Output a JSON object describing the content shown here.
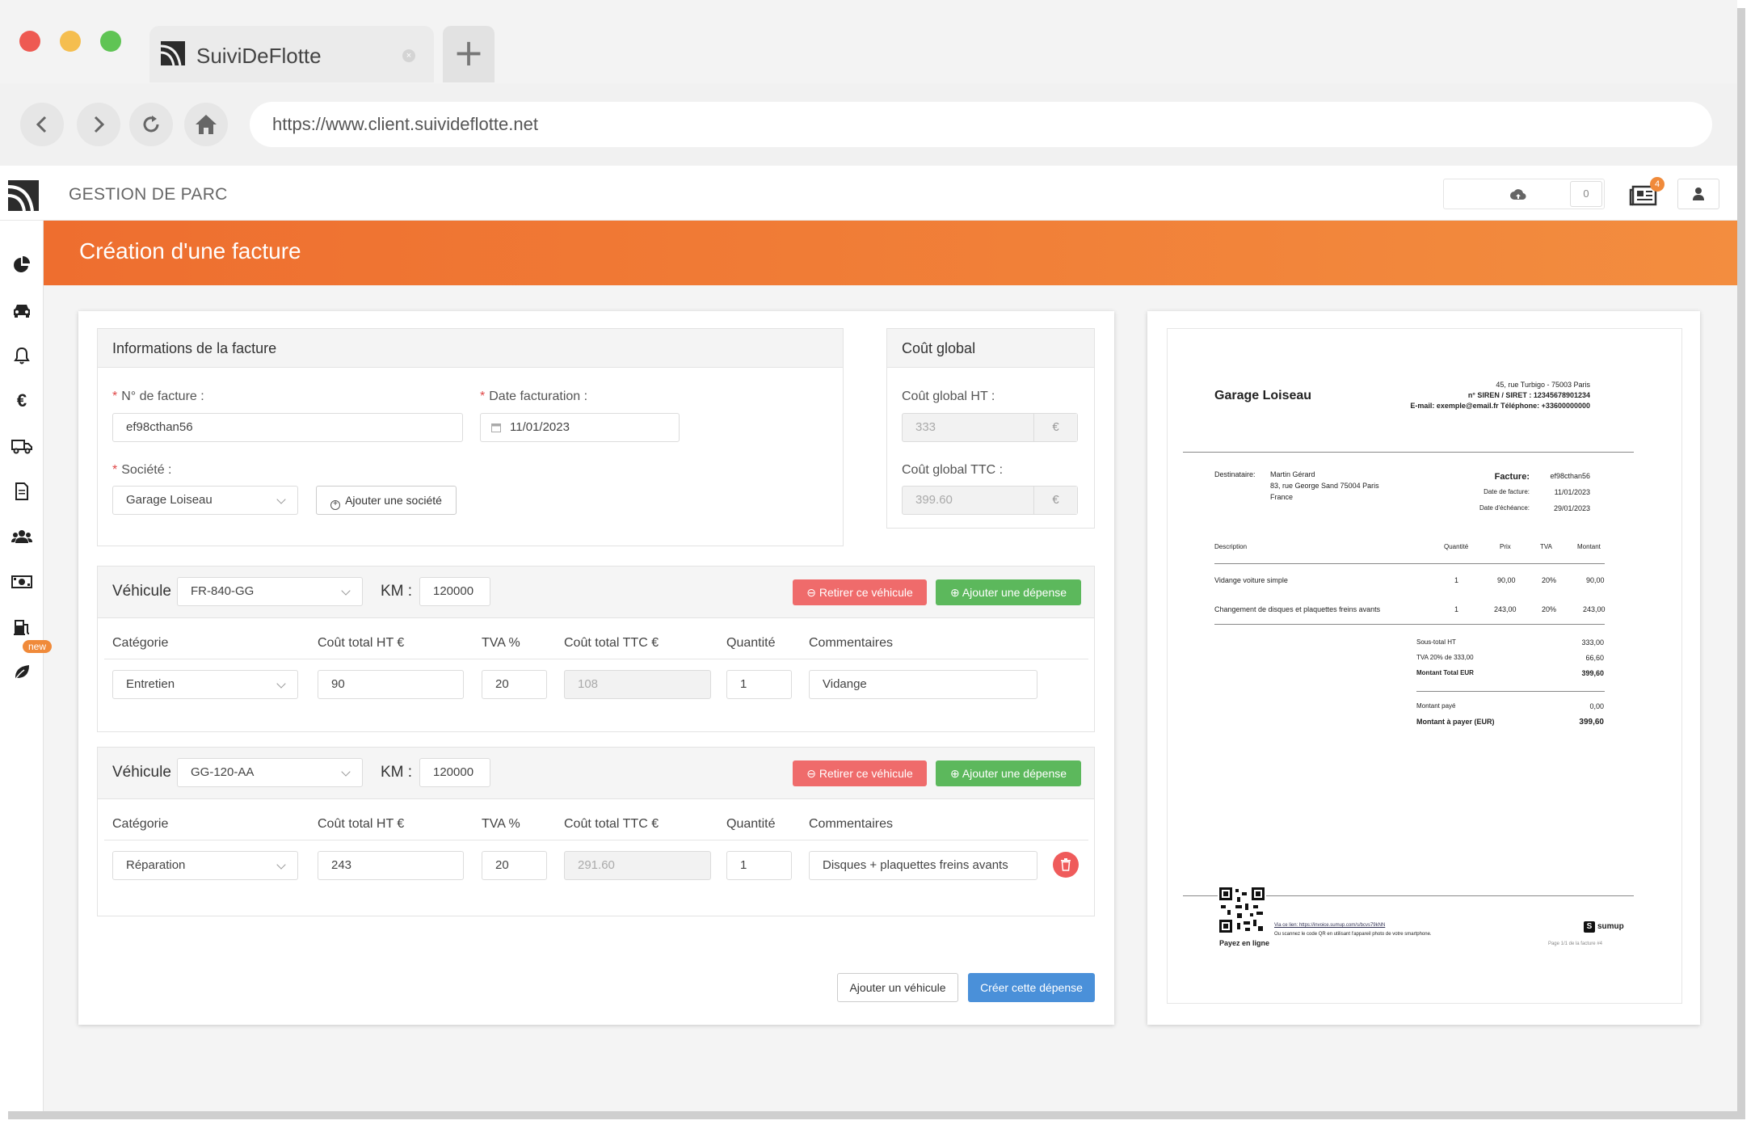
{
  "browser": {
    "tab_title": "SuiviDeFlotte",
    "new_tab": "+",
    "url": "https://www.client.suivideflotte.net"
  },
  "app": {
    "brand": "GESTION DE PARC",
    "sync_count": "0",
    "notification_count": "4",
    "new_badge": "new",
    "page_title": "Création d'une facture"
  },
  "invoice_info": {
    "title": "Informations de la facture",
    "invoice_number_label": "N° de facture :",
    "invoice_number": "ef98cthan56",
    "date_label": "Date facturation :",
    "date": "11/01/2023",
    "company_label": "Société :",
    "company": "Garage Loiseau",
    "add_company": "Ajouter une société"
  },
  "global_cost": {
    "title": "Coût global",
    "ht_label": "Coût global HT :",
    "ht_value": "333",
    "ttc_label": "Coût global TTC :",
    "ttc_value": "399.60",
    "currency": "€"
  },
  "vehicles": [
    {
      "label": "Véhicule",
      "plate": "FR-840-GG",
      "km_label": "KM :",
      "km": "120000",
      "remove_label": "Retirer ce véhicule",
      "add_expense_label": "Ajouter une dépense",
      "columns": [
        "Catégorie",
        "Coût total HT €",
        "TVA %",
        "Coût total TTC €",
        "Quantité",
        "Commentaires"
      ],
      "expense": {
        "category": "Entretien",
        "ht": "90",
        "tva": "20",
        "ttc": "108",
        "qty": "1",
        "comment": "Vidange"
      }
    },
    {
      "label": "Véhicule",
      "plate": "GG-120-AA",
      "km_label": "KM :",
      "km": "120000",
      "remove_label": "Retirer ce véhicule",
      "add_expense_label": "Ajouter une dépense",
      "columns": [
        "Catégorie",
        "Coût total HT €",
        "TVA %",
        "Coût total TTC €",
        "Quantité",
        "Commentaires"
      ],
      "expense": {
        "category": "Réparation",
        "ht": "243",
        "tva": "20",
        "ttc": "291.60",
        "qty": "1",
        "comment": "Disques + plaquettes freins avants"
      }
    }
  ],
  "actions": {
    "add_vehicle": "Ajouter un véhicule",
    "create": "Créer cette dépense"
  },
  "invoice_preview": {
    "company": "Garage Loiseau",
    "address": "45, rue Turbigo - 75003 Paris",
    "siren": "n° SIREN / SIRET : 12345678901234",
    "contact": "E-mail: exemple@email.fr   Téléphone: +33600000000",
    "recipient_label": "Destinataire:",
    "recipient_name": "Martin Gérard",
    "recipient_address": "83, rue George Sand 75004 Paris",
    "recipient_country": "France",
    "invoice_label": "Facture:",
    "invoice_number": "ef98cthan56",
    "date_label": "Date de facture:",
    "date": "11/01/2023",
    "due_label": "Date d'échéance:",
    "due": "29/01/2023",
    "table_headers": [
      "Description",
      "Quantité",
      "Prix",
      "TVA",
      "Montant"
    ],
    "lines": [
      {
        "description": "Vidange voiture simple",
        "qty": "1",
        "price": "90,00",
        "tva": "20%",
        "amount": "90,00"
      },
      {
        "description": "Changement de disques et plaquettes freins avants",
        "qty": "1",
        "price": "243,00",
        "tva": "20%",
        "amount": "243,00"
      }
    ],
    "subtotal_label": "Sous-total HT",
    "subtotal": "333,00",
    "tva_label": "TVA 20% de 333,00",
    "tva": "66,60",
    "total_label": "Montant Total EUR",
    "total": "399,60",
    "paid_label": "Montant payé",
    "paid": "0,00",
    "due_amount_label": "Montant à payer (EUR)",
    "due_amount": "399,60",
    "pay_online": "Payez en ligne",
    "pay_link_text": "Via ce lien: https://invoice.sumup.com/s/bcvs79kNN",
    "pay_qr_text": "Ou scannez le code QR en utilisant l'appareil photo de votre smartphone.",
    "sumup": "sumup",
    "page": "Page 1/1 de la facture #4"
  },
  "colors": {
    "orange": "#ee6e2f",
    "red": "#ef6b6b",
    "green": "#5cb85c",
    "blue": "#4a90d9"
  }
}
